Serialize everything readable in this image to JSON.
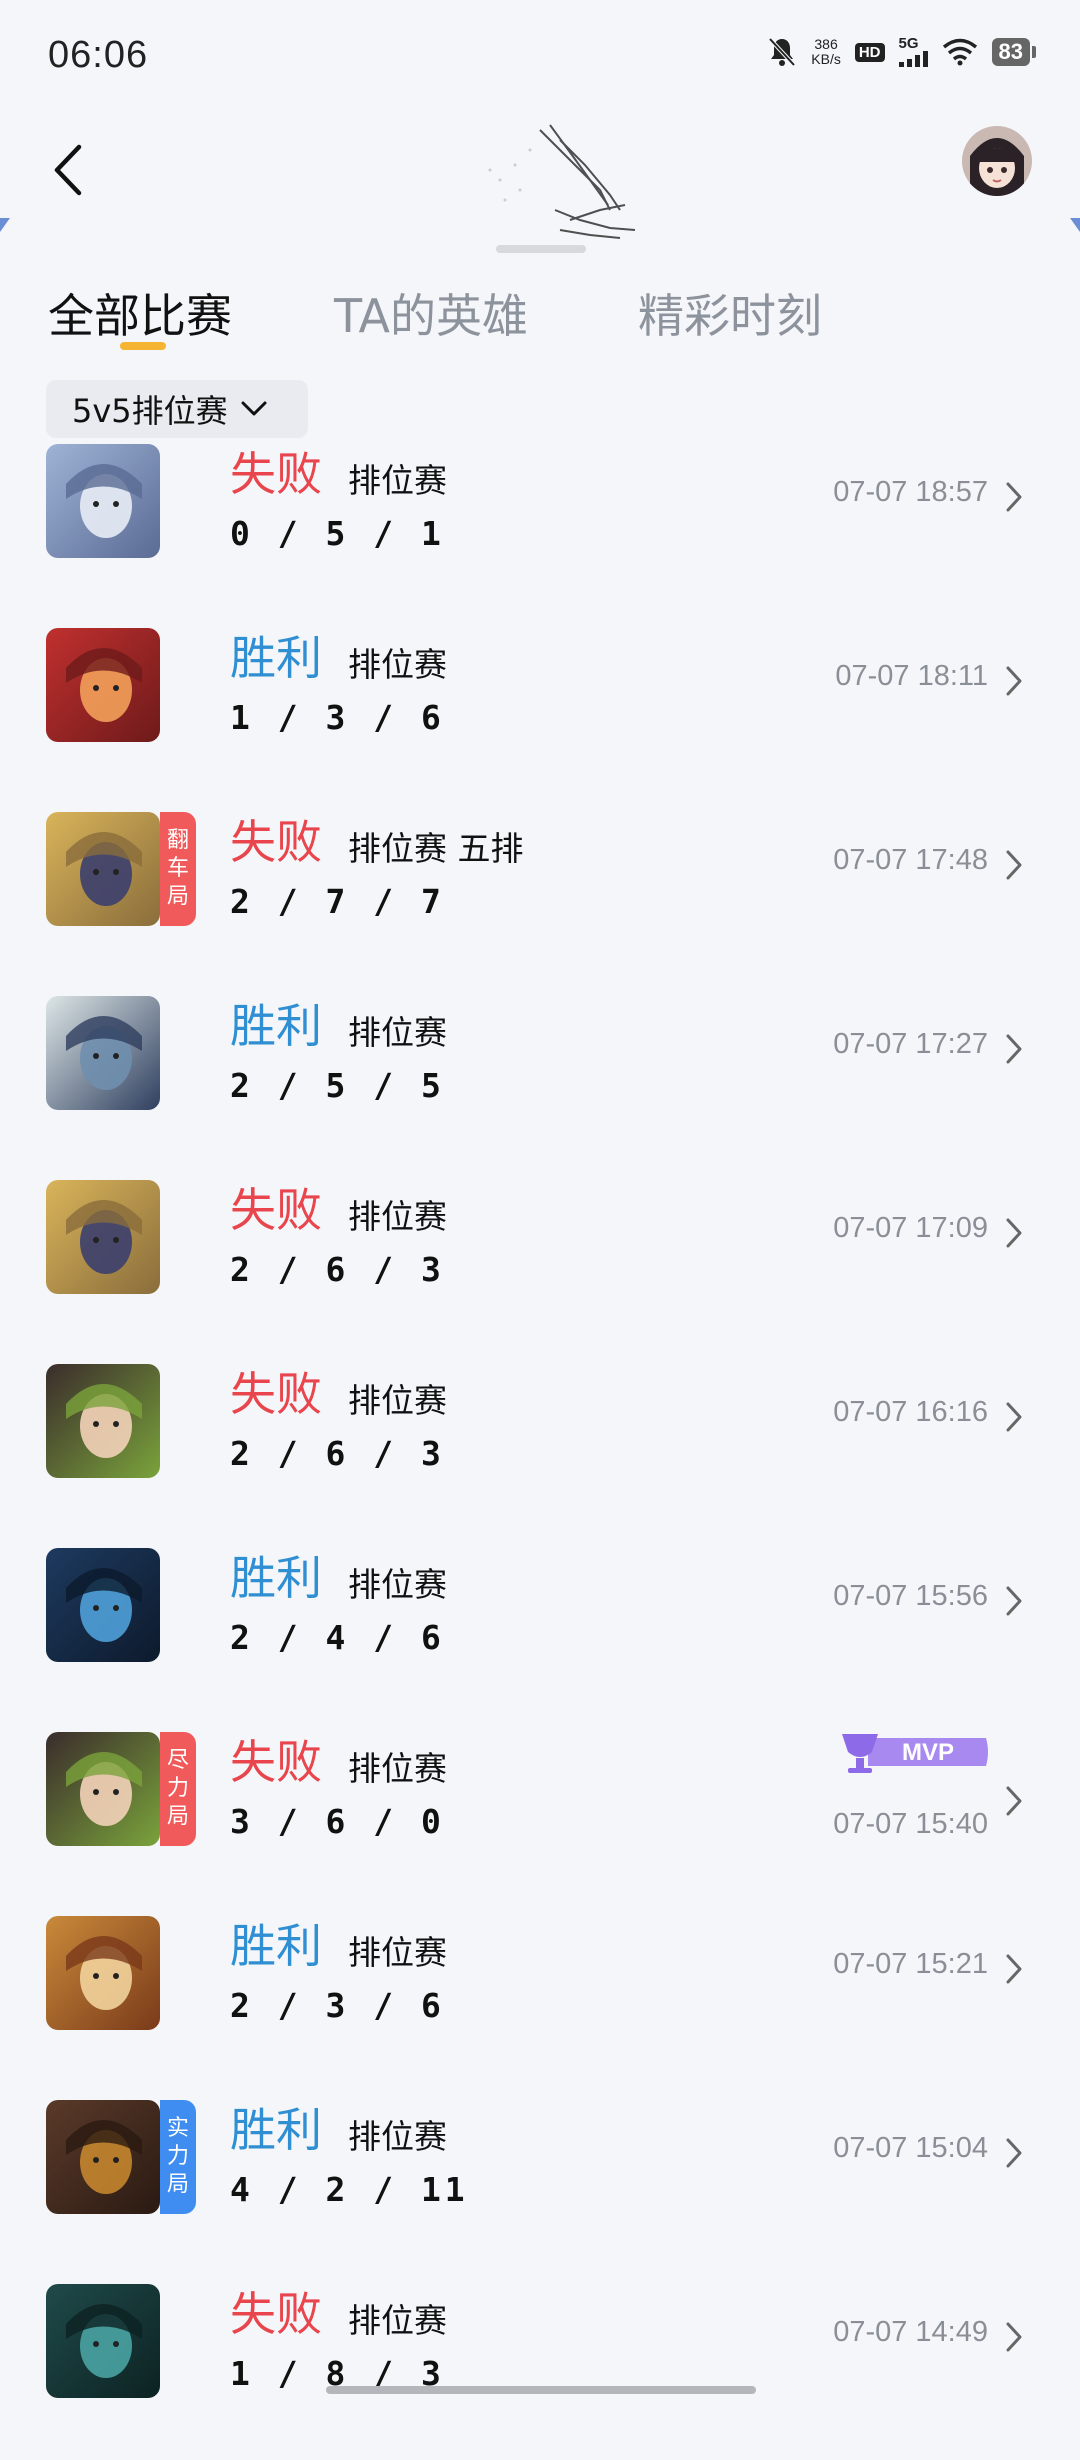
{
  "status_bar": {
    "time": "06:06",
    "net_speed_value": "386",
    "net_speed_unit": "KB/s",
    "hd": "HD",
    "signal": "5G",
    "battery": "83",
    "icons": [
      "bell-muted-icon",
      "wifi-icon",
      "battery-icon"
    ]
  },
  "header": {
    "back_icon": "chevron-left-icon",
    "avatar_icon": "user-avatar"
  },
  "tabs": [
    {
      "label": "全部比赛",
      "active": true
    },
    {
      "label": "TA的英雄",
      "active": false
    },
    {
      "label": "精彩时刻",
      "active": false
    }
  ],
  "filter": {
    "label": "5v5排位赛"
  },
  "matches": [
    {
      "result": "失败",
      "outcome": "lose",
      "mode": "排位赛",
      "kda": "0/5/1",
      "time": "07-07 18:57",
      "tag": "",
      "mvp": false
    },
    {
      "result": "胜利",
      "outcome": "win",
      "mode": "排位赛",
      "kda": "1/3/6",
      "time": "07-07 18:11",
      "tag": "",
      "mvp": false
    },
    {
      "result": "失败",
      "outcome": "lose",
      "mode": "排位赛 五排",
      "kda": "2/7/7",
      "time": "07-07 17:48",
      "tag": "翻车局",
      "tag_color": "red",
      "mvp": false
    },
    {
      "result": "胜利",
      "outcome": "win",
      "mode": "排位赛",
      "kda": "2/5/5",
      "time": "07-07 17:27",
      "tag": "",
      "mvp": false
    },
    {
      "result": "失败",
      "outcome": "lose",
      "mode": "排位赛",
      "kda": "2/6/3",
      "time": "07-07 17:09",
      "tag": "",
      "mvp": false
    },
    {
      "result": "失败",
      "outcome": "lose",
      "mode": "排位赛",
      "kda": "2/6/3",
      "time": "07-07 16:16",
      "tag": "",
      "mvp": false
    },
    {
      "result": "胜利",
      "outcome": "win",
      "mode": "排位赛",
      "kda": "2/4/6",
      "time": "07-07 15:56",
      "tag": "",
      "mvp": false
    },
    {
      "result": "失败",
      "outcome": "lose",
      "mode": "排位赛",
      "kda": "3/6/0",
      "time": "07-07 15:40",
      "tag": "尽力局",
      "tag_color": "red",
      "mvp": true
    },
    {
      "result": "胜利",
      "outcome": "win",
      "mode": "排位赛",
      "kda": "2/3/6",
      "time": "07-07 15:21",
      "tag": "",
      "mvp": false
    },
    {
      "result": "胜利",
      "outcome": "win",
      "mode": "排位赛",
      "kda": "4/2/11",
      "time": "07-07 15:04",
      "tag": "实力局",
      "tag_color": "blue",
      "mvp": false
    },
    {
      "result": "失败",
      "outcome": "lose",
      "mode": "排位赛",
      "kda": "1/8/3",
      "time": "07-07 14:49",
      "tag": "",
      "mvp": false
    }
  ],
  "mvp_label": "MVP",
  "colors": {
    "lose": "#e8454d",
    "win": "#2f8fd2",
    "tab_underline": "#f5b431",
    "background": "#f5f6fa"
  }
}
